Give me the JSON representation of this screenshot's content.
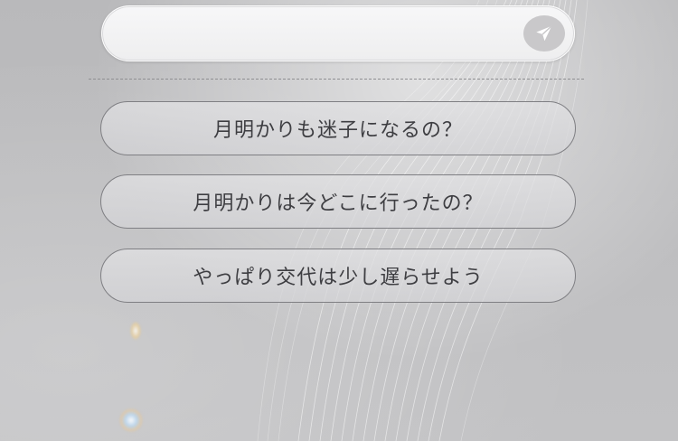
{
  "chat_input": {
    "value": "",
    "placeholder": ""
  },
  "send_button": {
    "icon": "send-icon"
  },
  "suggestions": [
    {
      "label": "月明かりも迷子になるの？"
    },
    {
      "label": "月明かりは今どこに行ったの？"
    },
    {
      "label": "やっぱり交代は少し遅らせよう"
    }
  ],
  "colors": {
    "background": "#bdbdbf",
    "input_background": "#f2f2f3",
    "send_button": "#c9c8ca",
    "suggestion_border": "#7f7f83",
    "suggestion_text": "#3e3e42"
  }
}
